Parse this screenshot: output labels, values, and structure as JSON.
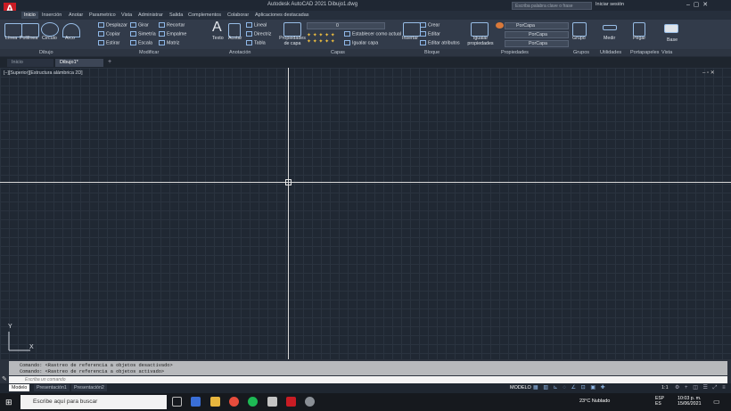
{
  "app": {
    "title": "Autodesk AutoCAD 2021   Dibujo1.dwg",
    "logo_letter": "A",
    "search_placeholder": "Escriba palabra clave o frase",
    "sign_in": "Iniciar sesión"
  },
  "menu_tabs": [
    "Inicio",
    "Inserción",
    "Anotar",
    "Parametrico",
    "Vista",
    "Administrar",
    "Salida",
    "Complementos",
    "Colaborar",
    "Aplicaciones destacadas"
  ],
  "ribbon": {
    "draw": [
      "Línea",
      "Polilínea",
      "Círculo",
      "Arco"
    ],
    "modify": [
      "Desplazar",
      "Girar",
      "Recortar",
      "Copiar",
      "Simetría",
      "Empalme",
      "Estirar",
      "Escala",
      "Matriz"
    ],
    "annotation": [
      "Texto",
      "Acotar",
      "Lineal",
      "Directriz",
      "Tabla"
    ],
    "layers": [
      "Propiedades de capa",
      "Establecer como actual",
      "Igualar capa"
    ],
    "layer_value": "0",
    "block": [
      "Insertar",
      "Crear",
      "Editar",
      "Editar atributos"
    ],
    "properties": [
      "Igualar propiedades",
      "PorCapa",
      "PorCapa",
      "PorCapa"
    ],
    "groups": [
      "Grupo"
    ],
    "utilities": [
      "Medir"
    ],
    "clipboard": [
      "Pegar"
    ],
    "view": [
      "Base"
    ]
  },
  "panel_labels": [
    "Dibujo",
    "Modificar",
    "Anotación",
    "Capas",
    "Bloque",
    "Propiedades",
    "Grupos",
    "Utilidades",
    "Portapapeles",
    "Vista"
  ],
  "doc_tabs": [
    "Inicio",
    "Dibujo1*"
  ],
  "viewport_label": "[–][Superior][Estructura alámbrica 2D]",
  "ucs": {
    "y": "Y",
    "x": "X"
  },
  "command": {
    "history": [
      "Comando:  <Rastreo de referencia a objetos desactivado>",
      "Comando:  <Rastreo de referencia a objetos activado>"
    ],
    "placeholder": "Escriba un comando"
  },
  "layout_tabs": [
    "Modelo",
    "Presentación1",
    "Presentación2"
  ],
  "status": {
    "model": "MODELO",
    "scale": "1:1"
  },
  "taskbar": {
    "search": "Escribe aquí para buscar",
    "weather": "23°C  Nublado",
    "lang": "ESP\nES",
    "time": "10:03 p. m.",
    "date": "15/06/2021"
  }
}
